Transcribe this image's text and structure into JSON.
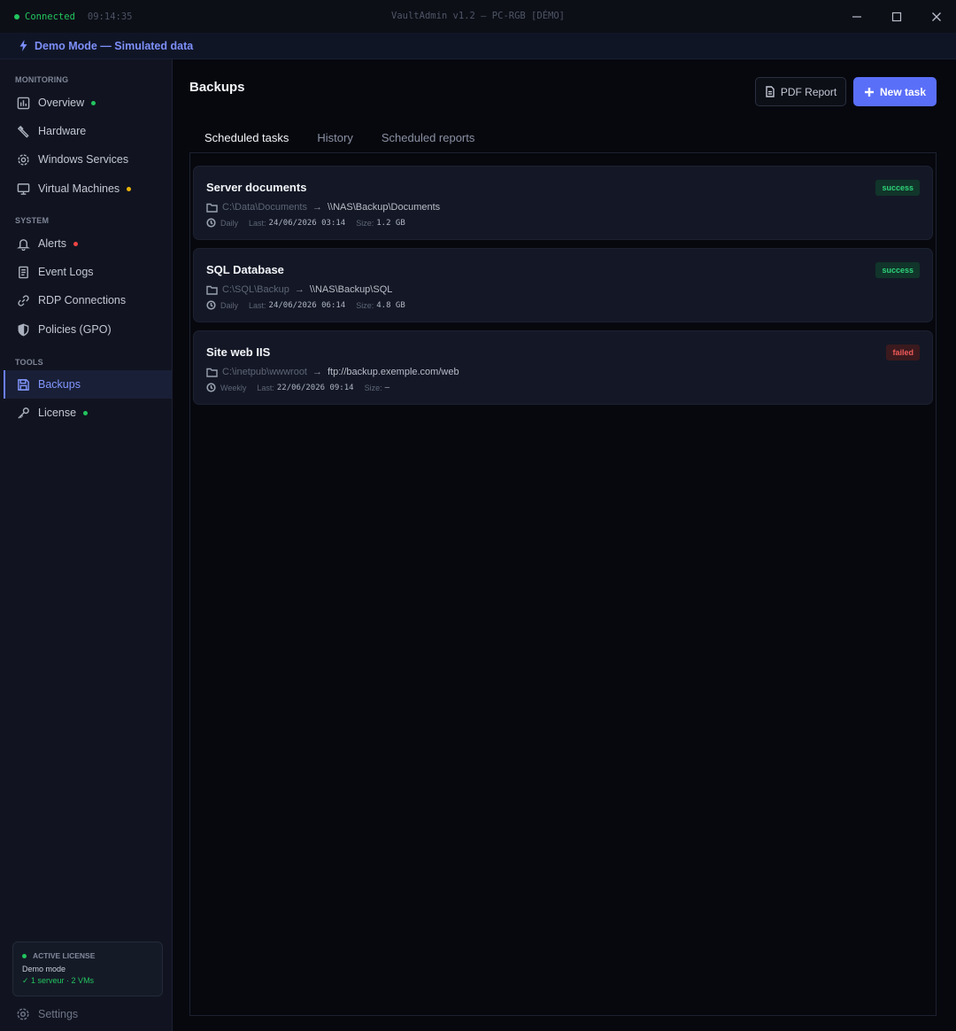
{
  "titlebar": {
    "status_label": "Connected",
    "clock": "09:14:35",
    "title": "VaultAdmin v1.2 — PC-RGB [DÉMO]",
    "status_color": "#22c55e"
  },
  "banner": {
    "text": "Demo Mode — Simulated data"
  },
  "sidebar": {
    "sections": {
      "monitoring": "MONITORING",
      "system": "SYSTEM",
      "tools": "TOOLS"
    },
    "items": [
      {
        "label": "Overview",
        "icon": "bar-chart-icon",
        "dot": "#22c55e"
      },
      {
        "label": "Hardware",
        "icon": "wrench-icon"
      },
      {
        "label": "Windows Services",
        "icon": "gear-icon"
      },
      {
        "label": "Virtual Machines",
        "icon": "server-icon",
        "dot": "#eab308"
      },
      {
        "label": "Alerts",
        "icon": "bell-icon",
        "dot": "#ef4444"
      },
      {
        "label": "Event Logs",
        "icon": "document-icon"
      },
      {
        "label": "RDP Connections",
        "icon": "link-icon"
      },
      {
        "label": "Policies (GPO)",
        "icon": "shield-icon"
      },
      {
        "label": "Backups",
        "icon": "save-icon",
        "active": true
      },
      {
        "label": "License",
        "icon": "key-icon",
        "dot": "#22c55e"
      }
    ],
    "license": {
      "heading": "ACTIVE LICENSE",
      "mode": "Demo mode",
      "detail": "✓ 1 serveur · 2 VMs"
    },
    "settings_label": "Settings"
  },
  "main": {
    "title": "Backups",
    "pdf_button": "PDF Report",
    "new_button": "New task",
    "tabs": [
      {
        "label": "Scheduled tasks",
        "active": true
      },
      {
        "label": "History"
      },
      {
        "label": "Scheduled reports"
      }
    ],
    "tasks": [
      {
        "name": "Server documents",
        "status": "success",
        "source": "C:\\Data\\Documents",
        "arrow": "→",
        "destination": "\\\\NAS\\Backup\\Documents",
        "frequency": "Daily",
        "last_label": "Last:",
        "last": "24/06/2026 03:14",
        "size_label": "Size:",
        "size": "1.2 GB"
      },
      {
        "name": "SQL Database",
        "status": "success",
        "source": "C:\\SQL\\Backup",
        "arrow": "→",
        "destination": "\\\\NAS\\Backup\\SQL",
        "frequency": "Daily",
        "last_label": "Last:",
        "last": "24/06/2026 06:14",
        "size_label": "Size:",
        "size": "4.8 GB"
      },
      {
        "name": "Site web IIS",
        "status": "failed",
        "source": "C:\\inetpub\\wwwroot",
        "arrow": "→",
        "destination": "ftp://backup.exemple.com/web",
        "frequency": "Weekly",
        "last_label": "Last:",
        "last": "22/06/2026 09:14",
        "size_label": "Size:",
        "size": "—"
      }
    ]
  }
}
